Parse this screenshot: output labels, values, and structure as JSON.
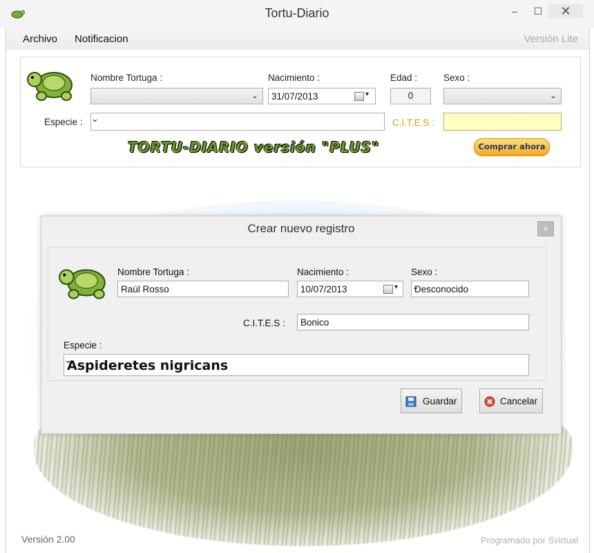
{
  "window": {
    "title": "Tortu-Diario",
    "minimize": "–",
    "maximize": "☐",
    "close": "✕"
  },
  "menu": {
    "archivo": "Archivo",
    "notificacion": "Notificacion",
    "version_lite": "Versión Lite"
  },
  "top_panel": {
    "nombre_label": "Nombre Tortuga :",
    "nombre_value": "",
    "nacimiento_label": "Nacimiento :",
    "nacimiento_value": "31/07/2013",
    "edad_label": "Edad :",
    "edad_value": "0",
    "sexo_label": "Sexo :",
    "sexo_value": "",
    "especie_label": "Especie :",
    "especie_value": "",
    "cites_label": "C.I.T.E.S :",
    "cites_value": "",
    "plus_banner": "TORTU-DIARIO versión \"PLUS\"",
    "buy_button": "Comprar ahora"
  },
  "dialog": {
    "title": "Crear nuevo registro",
    "close": "x",
    "nombre_label": "Nombre Tortuga :",
    "nombre_value": "Raúl Rosso",
    "nacimiento_label": "Nacimiento :",
    "nacimiento_value": "10/07/2013",
    "sexo_label": "Sexo :",
    "sexo_value": "Desconocido",
    "cites_label": "C.I.T.E.S :",
    "cites_value": "Bonico",
    "especie_label": "Especie :",
    "especie_value": "Aspideretes nigricans",
    "save_button": "Guardar",
    "cancel_button": "Cancelar"
  },
  "footer": {
    "version": "Versión 2.00",
    "credit": "Programado por Svirtual"
  },
  "icons": {
    "turtle": "turtle-icon",
    "save": "floppy-disk-icon",
    "cancel": "cancel-x-icon",
    "calendar": "calendar-icon",
    "dropdown": "chevron-down-icon"
  },
  "colors": {
    "cites_label": "#d4a000",
    "cites_field_bg": "#ffffc0",
    "buy_button": "#f5a623"
  }
}
